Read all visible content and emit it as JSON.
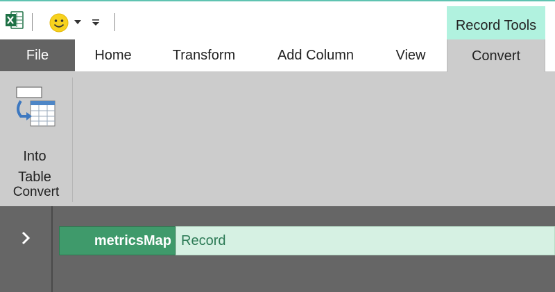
{
  "quick_access": {
    "app_icon": "excel-icon",
    "smiley_icon": "smiley-icon",
    "dropdown_icon": "dropdown-arrow-icon",
    "customize_icon": "customize-toolbar-icon"
  },
  "context_header": {
    "label": "Record Tools",
    "color": "#b1f2df"
  },
  "tabs": [
    {
      "label": "File"
    },
    {
      "label": "Home"
    },
    {
      "label": "Transform"
    },
    {
      "label": "Add Column"
    },
    {
      "label": "View"
    },
    {
      "label": "Convert",
      "active": true
    }
  ],
  "ribbon": {
    "into_table": {
      "line1": "Into",
      "line2": "Table",
      "icon": "into-table-icon"
    },
    "group_label": "Convert"
  },
  "content": {
    "nav_icon": "chevron-right-icon",
    "record": {
      "field": "metricsMap",
      "value": "Record"
    },
    "colors": {
      "field_bg": "#3f9a6b",
      "value_bg": "#d6f1e3",
      "panel_bg": "#666666"
    }
  }
}
